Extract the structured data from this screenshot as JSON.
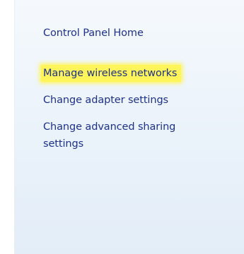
{
  "tasks_pane": {
    "home_link": "Control Panel Home",
    "links": [
      {
        "label": "Manage wireless networks",
        "highlighted": true
      },
      {
        "label": "Change adapter settings",
        "highlighted": false
      },
      {
        "label": "Change advanced sharing settings",
        "highlighted": false
      }
    ]
  },
  "colors": {
    "link": "#1e3287",
    "highlight": "#fff45a",
    "pane_background": "#eaf2fa"
  }
}
